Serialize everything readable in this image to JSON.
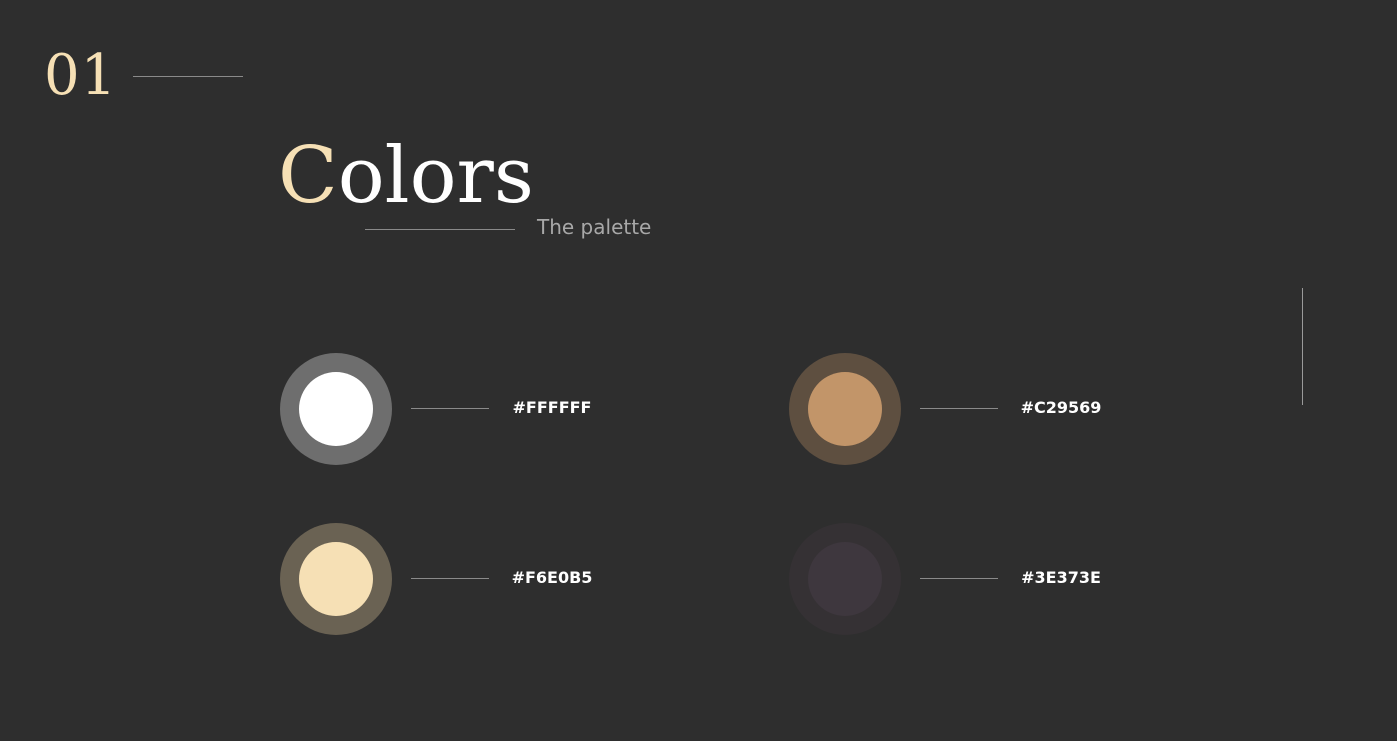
{
  "section": {
    "number": "01"
  },
  "heading": {
    "title_initial": "C",
    "title_rest": "olors",
    "subtitle": "The palette"
  },
  "palette": [
    {
      "hex": "#FFFFFF",
      "color": "#ffffff",
      "ring_color": "#6e6e6e"
    },
    {
      "hex": "#C29569",
      "color": "#c29569",
      "ring_color": "#5e4f40"
    },
    {
      "hex": "#F6E0B5",
      "color": "#f6e0b5",
      "ring_color": "#6a6253"
    },
    {
      "hex": "#3E373E",
      "color": "#3e373e",
      "ring_color": "#353134"
    }
  ]
}
